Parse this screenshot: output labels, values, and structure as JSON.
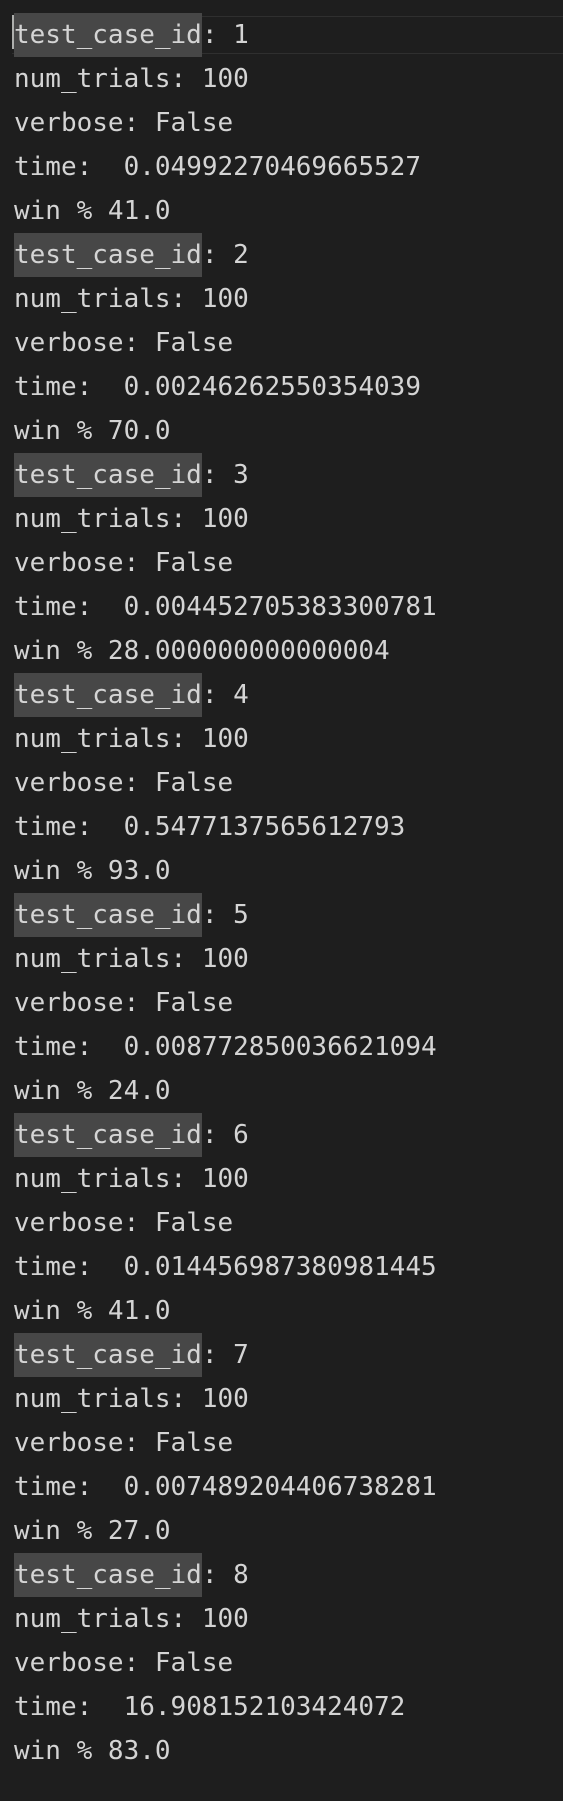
{
  "output": {
    "highlight_term": "test_case_id",
    "runs": [
      {
        "id": "1",
        "num_trials": "100",
        "verbose": "False",
        "time": "0.04992270469665527",
        "win": "41.0"
      },
      {
        "id": "2",
        "num_trials": "100",
        "verbose": "False",
        "time": "0.00246262550354039",
        "win": "70.0"
      },
      {
        "id": "3",
        "num_trials": "100",
        "verbose": "False",
        "time": "0.004452705383300781",
        "win": "28.000000000000004"
      },
      {
        "id": "4",
        "num_trials": "100",
        "verbose": "False",
        "time": "0.5477137565612793",
        "win": "93.0"
      },
      {
        "id": "5",
        "num_trials": "100",
        "verbose": "False",
        "time": "0.008772850036621094",
        "win": "24.0"
      },
      {
        "id": "6",
        "num_trials": "100",
        "verbose": "False",
        "time": "0.014456987380981445",
        "win": "41.0"
      },
      {
        "id": "7",
        "num_trials": "100",
        "verbose": "False",
        "time": "0.007489204406738281",
        "win": "27.0"
      },
      {
        "id": "8",
        "num_trials": "100",
        "verbose": "False",
        "time": "16.908152103424072",
        "win": "83.0"
      }
    ]
  },
  "labels": {
    "num_trials": "num_trials: ",
    "verbose": "verbose: ",
    "time": "time:  ",
    "win": "win % ",
    "id_sep": ": "
  },
  "colors": {
    "background": "#1e1e1e",
    "text": "#d4d4d4",
    "find_highlight": "#474747"
  }
}
